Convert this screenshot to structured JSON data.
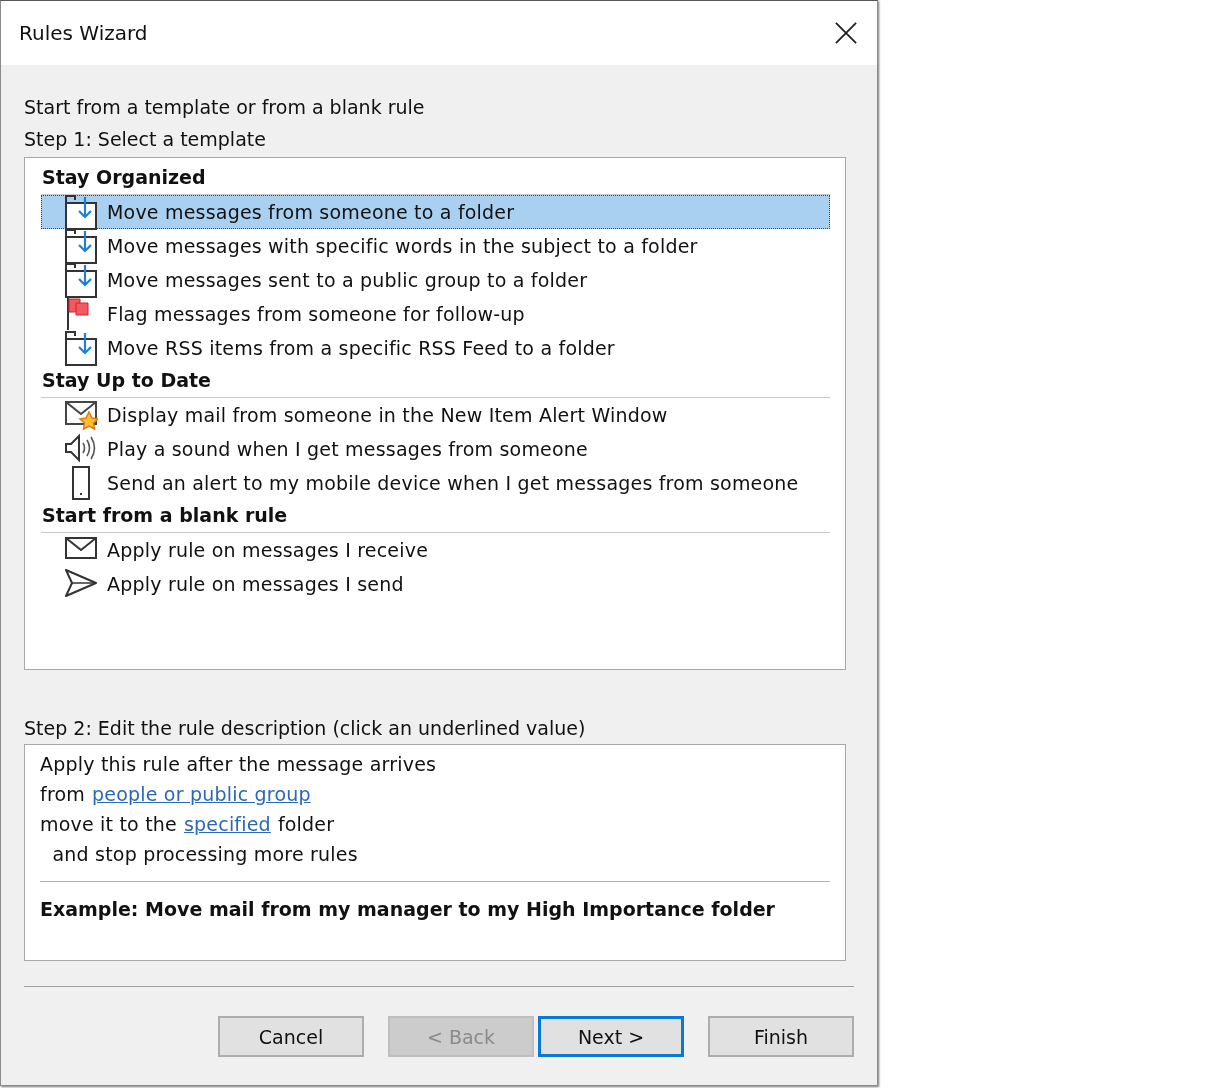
{
  "window": {
    "title": "Rules Wizard"
  },
  "intro": "Start from a template or from a blank rule",
  "step1": "Step 1: Select a template",
  "template_groups": [
    {
      "heading": "Stay Organized",
      "items": [
        {
          "kind": "move",
          "label": "Move messages from someone to a folder",
          "selected": true
        },
        {
          "kind": "move",
          "label": "Move messages with specific words in the subject to a folder",
          "selected": false
        },
        {
          "kind": "move",
          "label": "Move messages sent to a public group to a folder",
          "selected": false
        },
        {
          "kind": "flag",
          "label": "Flag messages from someone for follow-up",
          "selected": false
        },
        {
          "kind": "move",
          "label": "Move RSS items from a specific RSS Feed to a folder",
          "selected": false
        }
      ]
    },
    {
      "heading": "Stay Up to Date",
      "items": [
        {
          "kind": "alert",
          "label": "Display mail from someone in the New Item Alert Window",
          "selected": false
        },
        {
          "kind": "sound",
          "label": "Play a sound when I get messages from someone",
          "selected": false
        },
        {
          "kind": "mobile",
          "label": "Send an alert to my mobile device when I get messages from someone",
          "selected": false
        }
      ]
    },
    {
      "heading": "Start from a blank rule",
      "items": [
        {
          "kind": "receive",
          "label": "Apply rule on messages I receive",
          "selected": false
        },
        {
          "kind": "send",
          "label": "Apply rule on messages I send",
          "selected": false
        }
      ]
    }
  ],
  "step2": "Step 2: Edit the rule description (click an underlined value)",
  "description": {
    "lines": [
      {
        "parts": [
          {
            "text": "Apply this rule after the message arrives",
            "link": false
          }
        ]
      },
      {
        "parts": [
          {
            "text": "from",
            "link": false
          },
          {
            "text": "people or public group",
            "link": true
          }
        ]
      },
      {
        "parts": [
          {
            "text": "move it to the",
            "link": false
          },
          {
            "text": "specified",
            "link": true
          },
          {
            "text": "folder",
            "link": false
          }
        ]
      },
      {
        "parts": [
          {
            "text": "  and stop processing more rules",
            "link": false
          }
        ]
      }
    ],
    "example": "Example: Move mail from my manager to my High Importance folder"
  },
  "buttons": [
    {
      "label": "Cancel",
      "disabled": false,
      "default": false
    },
    {
      "label": "< Back",
      "disabled": true,
      "default": false
    },
    {
      "label": "Next >",
      "disabled": false,
      "default": true
    },
    {
      "label": "Finish",
      "disabled": false,
      "default": false
    }
  ]
}
